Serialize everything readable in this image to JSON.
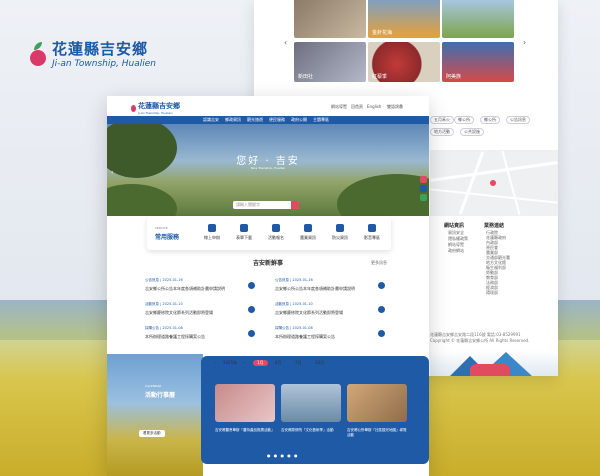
{
  "brand": {
    "name_zh": "花蓮縣吉安鄉",
    "name_en": "Ji-an Township, Hualien"
  },
  "gallery": {
    "tiles": [
      {
        "label": ""
      },
      {
        "label": "金針花海"
      },
      {
        "label": ""
      },
      {
        "label": "新田社"
      },
      {
        "label": "紅藜季"
      },
      {
        "label": "阿美族"
      }
    ]
  },
  "back_page": {
    "chips": [
      "五月禾火",
      "鄉公所",
      "鄉公所",
      "公告訊息",
      "地方活動",
      "公共設施"
    ],
    "footer_left_head": "網站資訊",
    "footer_left_links": [
      "資訊安全",
      "隱私權政策",
      "網站導覽",
      "政府網站"
    ],
    "footer_right_head": "業務連結",
    "footer_right_links": [
      "行政院",
      "花蓮縣政府",
      "內政部",
      "原民會",
      "農業部",
      "交通部觀光署",
      "地方文化館",
      "衛生福利部",
      "勞動部",
      "教育部",
      "法務部",
      "經濟部",
      "環境部"
    ],
    "address": "花蓮縣吉安鄉吉安路二段116號 電話:03-8529991",
    "copyright": "Copyright © 花蓮縣吉安鄉公所 All Rights Reserved."
  },
  "front": {
    "logo_zh": "花蓮縣吉安鄉",
    "logo_en": "Ji-an Township, Hualien",
    "util_links": [
      "網站導覽",
      "回首頁",
      "English",
      "雙語詞彙"
    ],
    "nav": [
      "認識吉安",
      "鄉政資訊",
      "觀光旅遊",
      "便民服務",
      "政府公開",
      "主題專區"
    ],
    "hero_title": "您好 · 吉安",
    "hero_subtitle": "Nice Township, Hualien",
    "search_placeholder": "請輸入關鍵字",
    "services_tag": "SERVICE",
    "services_title": "常用服務",
    "services": [
      "線上申辦",
      "表單下載",
      "活動報名",
      "農業資訊",
      "防災資訊",
      "影音專區"
    ],
    "news_title": "吉安新鮮事",
    "news_more": "更多訊息",
    "news": [
      {
        "date": "公告訊息 | 2025-01-16",
        "title": "吉安鄉公所公告本年度各項補助計畫申請說明"
      },
      {
        "date": "活動訊息 | 2025-01-10",
        "title": "吉安鄉慶修院文化節系列活動即將登場"
      },
      {
        "date": "採購公告 | 2025-01-08",
        "title": "本所辦理道路養護工程採購案公告"
      },
      {
        "date": "公告訊息 | 2025-01-16",
        "title": "吉安鄉公所公告本年度各項補助計畫申請說明"
      },
      {
        "date": "活動訊息 | 2025-01-10",
        "title": "吉安鄉慶修院文化節系列活動即將登場"
      },
      {
        "date": "採購公告 | 2025-01-08",
        "title": "本所辦理道路養護工程採購案公告"
      }
    ],
    "activity_tag": "CALENDAR",
    "activity_title": "活動行事曆",
    "activity_more": "看更多活動",
    "year": "2025年",
    "months": [
      "1月",
      "4月",
      "7月",
      "10月"
    ],
    "cards": [
      {
        "caption": "吉安鄉農會舉辦「農特產品推廣活動」"
      },
      {
        "caption": "吉安鄉慶修院「文化藝術季」活動"
      },
      {
        "caption": "吉安鄉公所舉辦「社區觀光地圖」導覽活動"
      }
    ]
  }
}
